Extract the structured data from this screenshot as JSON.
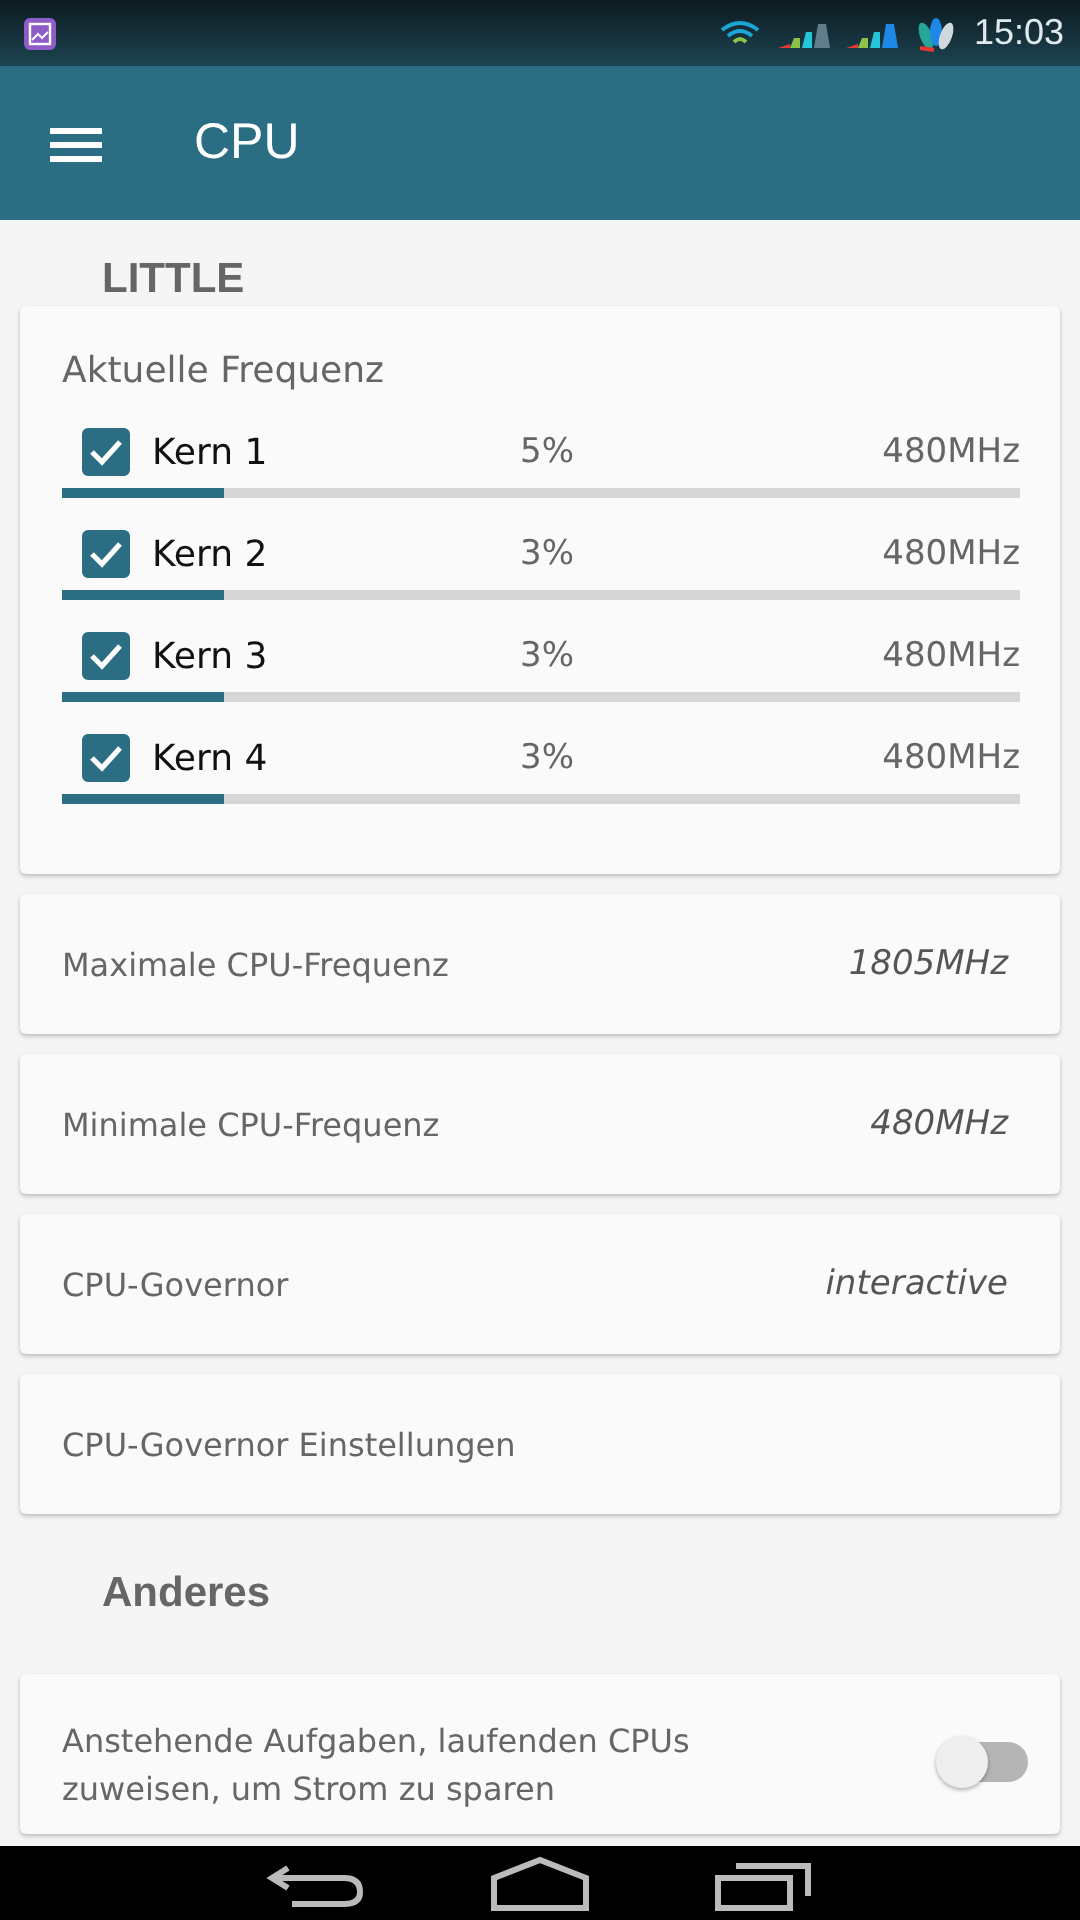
{
  "status_bar": {
    "time": "15:03"
  },
  "toolbar": {
    "title": "CPU"
  },
  "sections": [
    {
      "title": "LITTLE",
      "cards": [
        {
          "kind": "cores",
          "title": "Aktuelle Frequenz",
          "cores": [
            {
              "name": "Kern 1",
              "checked": true,
              "usage": "5%",
              "frequency": "480MHz",
              "level": 0.17
            },
            {
              "name": "Kern 2",
              "checked": true,
              "usage": "3%",
              "frequency": "480MHz",
              "level": 0.17
            },
            {
              "name": "Kern 3",
              "checked": true,
              "usage": "3%",
              "frequency": "480MHz",
              "level": 0.17
            },
            {
              "name": "Kern 4",
              "checked": true,
              "usage": "3%",
              "frequency": "480MHz",
              "level": 0.17
            }
          ]
        },
        {
          "kind": "value",
          "label": "Maximale CPU-Frequenz",
          "value": "1805MHz"
        },
        {
          "kind": "value",
          "label": "Minimale CPU-Frequenz",
          "value": "480MHz"
        },
        {
          "kind": "value",
          "label": "CPU-Governor",
          "value": "interactive"
        },
        {
          "kind": "plain",
          "label": "CPU-Governor Einstellungen"
        }
      ]
    },
    {
      "title": "Anderes",
      "cards": [
        {
          "kind": "switch",
          "label": "Anstehende Aufgaben, laufenden CPUs zuweisen, um Strom zu sparen",
          "on": false
        }
      ]
    }
  ]
}
